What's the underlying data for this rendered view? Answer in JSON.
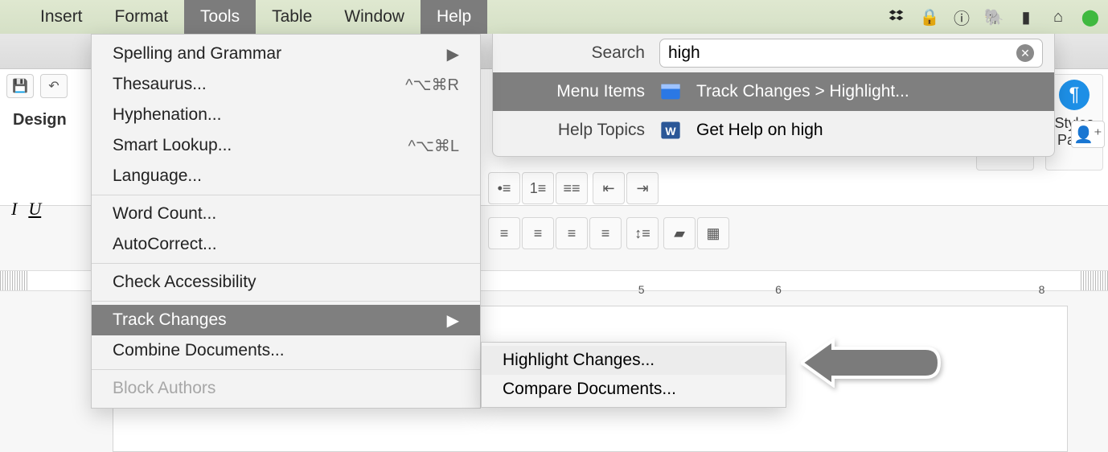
{
  "menubar": {
    "items": [
      "Insert",
      "Format",
      "Tools",
      "Table",
      "Window",
      "Help"
    ],
    "active": [
      "Tools",
      "Help"
    ]
  },
  "tools_menu": {
    "items": [
      {
        "label": "Spelling and Grammar",
        "arrow": true
      },
      {
        "label": "Thesaurus...",
        "shortcut": "^⌥⌘R"
      },
      {
        "label": "Hyphenation..."
      },
      {
        "label": "Smart Lookup...",
        "shortcut": "^⌥⌘L"
      },
      {
        "label": "Language..."
      }
    ],
    "items2": [
      {
        "label": "Word Count..."
      },
      {
        "label": "AutoCorrect..."
      }
    ],
    "items3": [
      {
        "label": "Check Accessibility"
      }
    ],
    "items4": [
      {
        "label": "Track Changes",
        "arrow": true,
        "active": true
      },
      {
        "label": "Combine Documents..."
      }
    ],
    "items5": [
      {
        "label": "Block Authors",
        "disabled": true
      }
    ]
  },
  "track_submenu": {
    "items": [
      {
        "label": "Highlight Changes...",
        "active": true
      },
      {
        "label": "Compare Documents..."
      }
    ]
  },
  "help_panel": {
    "search_label": "Search",
    "search_value": "high",
    "row_menu_label": "Menu Items",
    "row_menu_result": "Track Changes > Highlight...",
    "row_helptopics_label": "Help Topics",
    "row_helptopics_result": "Get Help on high"
  },
  "ribbon": {
    "tab_design": "Design",
    "styles_label": "Styles",
    "styles_pane_label": "Styles\nPane",
    "italic_glyph": "I",
    "underline_glyph": "U"
  },
  "ruler": {
    "marks": [
      "5",
      "6",
      "8"
    ]
  }
}
